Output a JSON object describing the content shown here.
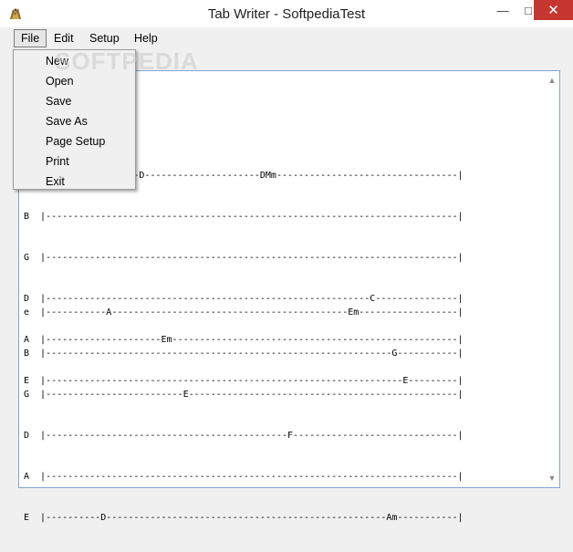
{
  "window": {
    "title": "Tab Writer - SoftpediaTest",
    "icons": {
      "app": "app-icon",
      "minimize": "minimize-icon",
      "maximize": "maximize-icon",
      "close": "close-icon"
    }
  },
  "menubar": {
    "items": [
      {
        "label": "File"
      },
      {
        "label": "Edit"
      },
      {
        "label": "Setup"
      },
      {
        "label": "Help"
      }
    ]
  },
  "file_menu": {
    "items": [
      {
        "label": "New"
      },
      {
        "label": "Open"
      },
      {
        "label": "Save"
      },
      {
        "label": "Save As"
      },
      {
        "label": "Page Setup"
      },
      {
        "label": "Print"
      },
      {
        "label": "Exit"
      }
    ]
  },
  "watermark": "SOFTPEDIA",
  "editor": {
    "block1": [
      "e  |-----------------D---------------------DMm---------------------------------|",
      "B  |---------------------------------------------------------------------------|",
      "G  |---------------------------------------------------------------------------|",
      "D  |-----------------------------------------------------------C---------------|",
      "A  |---------------------Em----------------------------------------------------|",
      "E  |-----------------------------------------------------------------E---------|"
    ],
    "block2": [
      "e  |-----------A-------------------------------------------Em------------------|",
      "B  |---------------------------------------------------------------G-----------|",
      "G  |-------------------------E-------------------------------------------------|",
      "D  |--------------------------------------------F------------------------------|",
      "A  |---------------------------------------------------------------------------|",
      "E  |----------D---------------------------------------------------Am-----------|"
    ]
  },
  "colors": {
    "accent_border": "#7ea6d4",
    "close_button": "#c7372f"
  }
}
